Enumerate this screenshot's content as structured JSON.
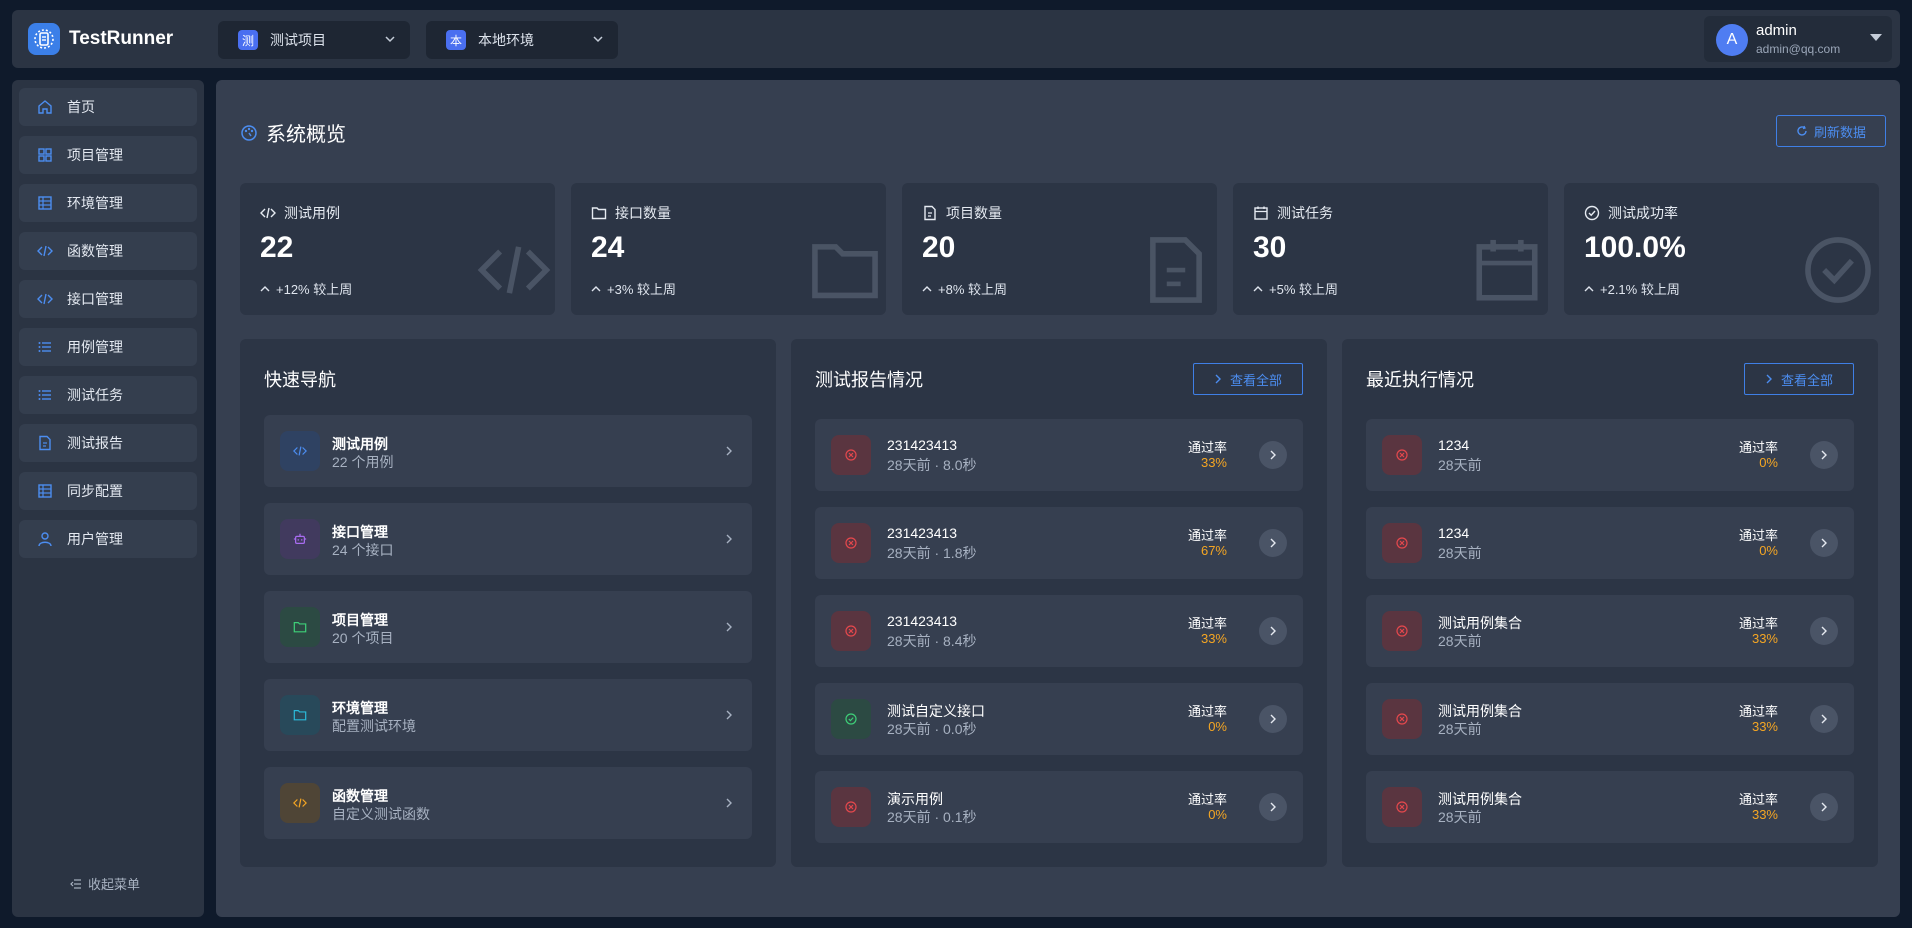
{
  "app": {
    "name": "TestRunner"
  },
  "project_selector": {
    "badge": "测",
    "label": "测试项目"
  },
  "env_selector": {
    "badge": "本",
    "label": "本地环境"
  },
  "user": {
    "initial": "A",
    "name": "admin",
    "email": "admin@qq.com"
  },
  "sidebar": {
    "items": [
      {
        "label": "首页",
        "icon": "home-icon"
      },
      {
        "label": "项目管理",
        "icon": "grid-icon"
      },
      {
        "label": "环境管理",
        "icon": "table-icon"
      },
      {
        "label": "函数管理",
        "icon": "code-icon"
      },
      {
        "label": "接口管理",
        "icon": "code-icon"
      },
      {
        "label": "用例管理",
        "icon": "list-icon"
      },
      {
        "label": "测试任务",
        "icon": "list-icon"
      },
      {
        "label": "测试报告",
        "icon": "document-icon"
      },
      {
        "label": "同步配置",
        "icon": "table-icon"
      },
      {
        "label": "用户管理",
        "icon": "user-icon"
      }
    ],
    "collapse_label": "收起菜单"
  },
  "overview": {
    "title": "系统概览",
    "refresh_label": "刷新数据"
  },
  "stats": [
    {
      "label": "测试用例",
      "value": "22",
      "trend": "+12% 较上周",
      "icon": "code-icon"
    },
    {
      "label": "接口数量",
      "value": "24",
      "trend": "+3% 较上周",
      "icon": "folder-icon"
    },
    {
      "label": "项目数量",
      "value": "20",
      "trend": "+8% 较上周",
      "icon": "document-icon"
    },
    {
      "label": "测试任务",
      "value": "30",
      "trend": "+5% 较上周",
      "icon": "calendar-icon"
    },
    {
      "label": "测试成功率",
      "value": "100.0%",
      "trend": "+2.1% 较上周",
      "icon": "check-circle-icon"
    }
  ],
  "quick_nav": {
    "title": "快速导航",
    "items": [
      {
        "title": "测试用例",
        "sub": "22 个用例",
        "icon": "code-icon",
        "color": "#4c8df0",
        "bg": "#2f4262"
      },
      {
        "title": "接口管理",
        "sub": "24 个接口",
        "icon": "robot-icon",
        "color": "#a86cf0",
        "bg": "#413a5e"
      },
      {
        "title": "项目管理",
        "sub": "20 个项目",
        "icon": "folder-icon",
        "color": "#3ecf78",
        "bg": "#2c4a43"
      },
      {
        "title": "环境管理",
        "sub": "配置测试环境",
        "icon": "folder-icon",
        "color": "#2bb8d8",
        "bg": "#28495a"
      },
      {
        "title": "函数管理",
        "sub": "自定义测试函数",
        "icon": "code-icon",
        "color": "#f5a623",
        "bg": "#4f4536"
      }
    ]
  },
  "reports": {
    "title": "测试报告情况",
    "view_all": "查看全部",
    "rate_label": "通过率",
    "items": [
      {
        "title": "231423413",
        "sub": "28天前 · 8.0秒",
        "rate": "33%",
        "status": "fail"
      },
      {
        "title": "231423413",
        "sub": "28天前 · 1.8秒",
        "rate": "67%",
        "status": "fail"
      },
      {
        "title": "231423413",
        "sub": "28天前 · 8.4秒",
        "rate": "33%",
        "status": "fail"
      },
      {
        "title": "测试自定义接口",
        "sub": "28天前 · 0.0秒",
        "rate": "0%",
        "status": "pass"
      },
      {
        "title": "演示用例",
        "sub": "28天前 · 0.1秒",
        "rate": "0%",
        "status": "fail"
      }
    ]
  },
  "recent": {
    "title": "最近执行情况",
    "view_all": "查看全部",
    "rate_label": "通过率",
    "items": [
      {
        "title": "1234",
        "sub": "28天前",
        "rate": "0%",
        "status": "fail"
      },
      {
        "title": "1234",
        "sub": "28天前",
        "rate": "0%",
        "status": "fail"
      },
      {
        "title": "测试用例集合",
        "sub": "28天前",
        "rate": "33%",
        "status": "fail"
      },
      {
        "title": "测试用例集合",
        "sub": "28天前",
        "rate": "33%",
        "status": "fail"
      },
      {
        "title": "测试用例集合",
        "sub": "28天前",
        "rate": "33%",
        "status": "fail"
      }
    ]
  },
  "colors": {
    "accent": "#3f7fe6",
    "fail": "#e5484d",
    "pass": "#3ecf78",
    "rate": "#f5a623"
  }
}
